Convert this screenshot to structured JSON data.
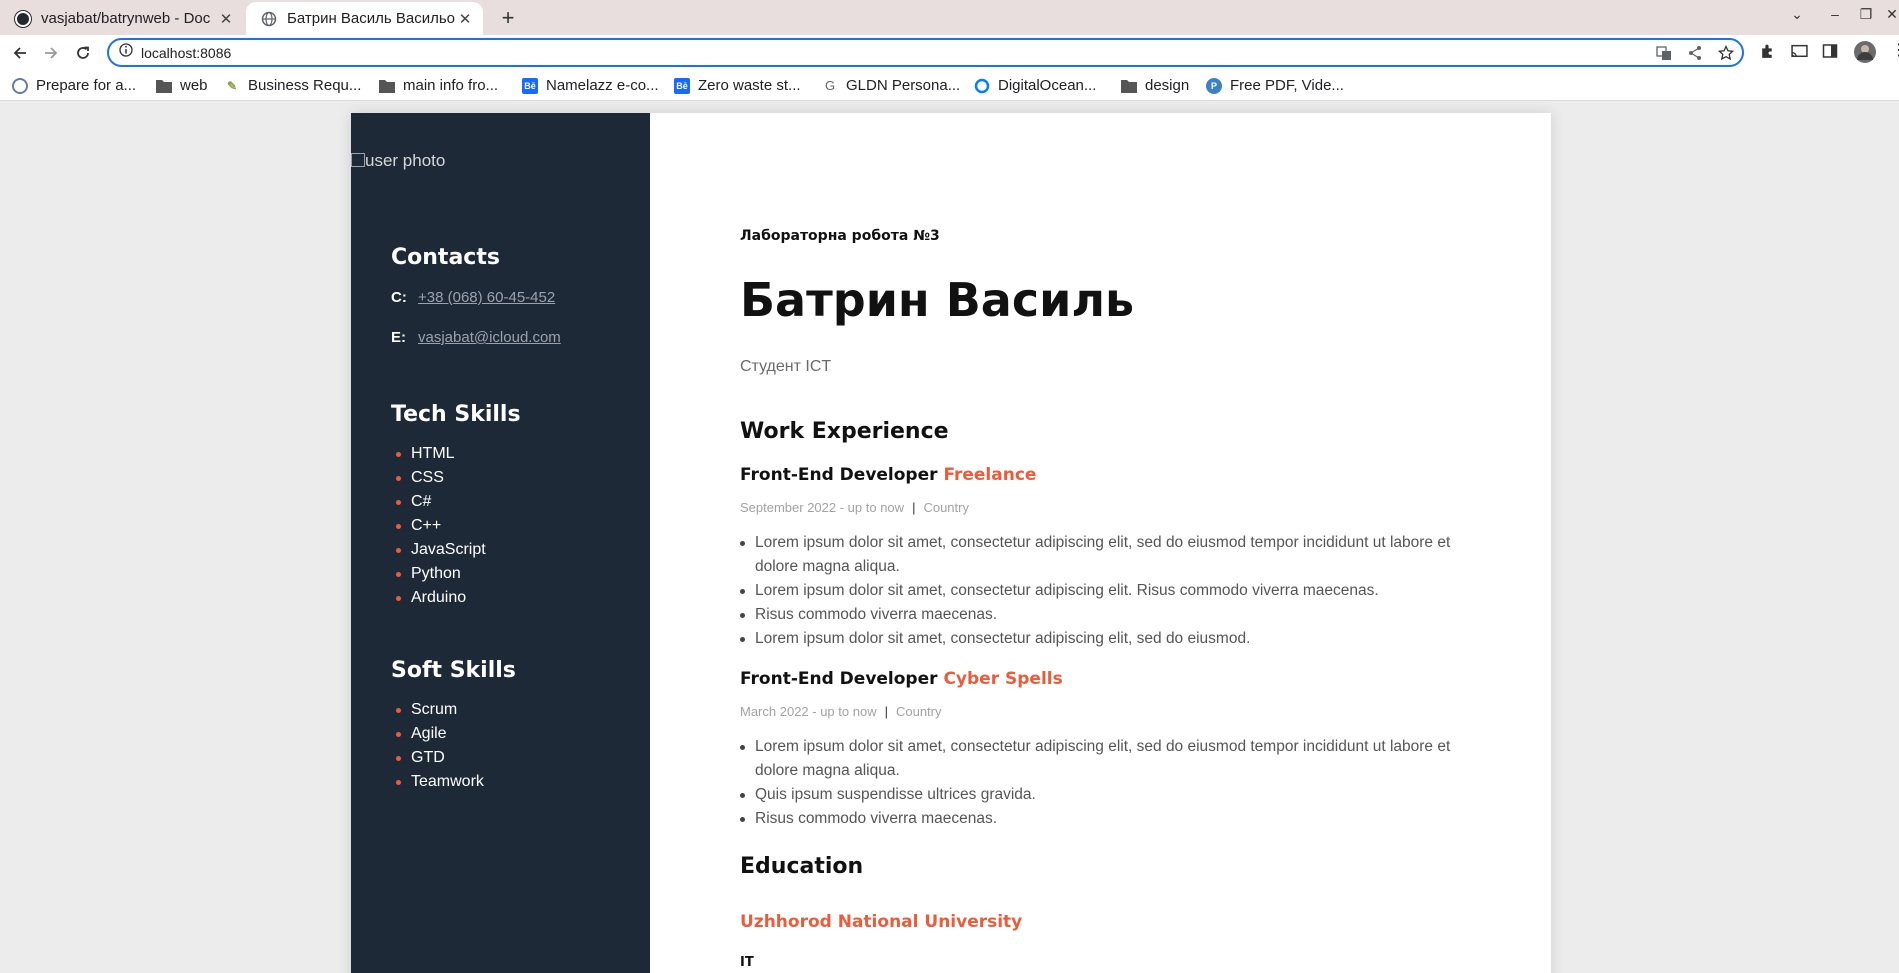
{
  "browser": {
    "tabs": [
      {
        "title": "vasjabat/batrynweb - Doc",
        "active": false
      },
      {
        "title": "Батрин Василь Васильо",
        "active": true
      }
    ],
    "url": "localhost:8086",
    "bookmarks": [
      {
        "label": "Prepare for a...",
        "icon": "page-icon"
      },
      {
        "label": "web",
        "icon": "folder-icon"
      },
      {
        "label": "Business Requ...",
        "icon": "site-icon"
      },
      {
        "label": "main info fro...",
        "icon": "folder-icon"
      },
      {
        "label": "Namelazz e-co...",
        "icon": "behance-icon"
      },
      {
        "label": "Zero waste st...",
        "icon": "behance-icon"
      },
      {
        "label": "GLDN Persona...",
        "icon": "google-icon"
      },
      {
        "label": "DigitalOcean...",
        "icon": "digitalocean-icon"
      },
      {
        "label": "design",
        "icon": "folder-icon"
      },
      {
        "label": "Free PDF, Vide...",
        "icon": "site-icon"
      }
    ]
  },
  "sidebar": {
    "photo_alt": "user photo",
    "contacts": {
      "heading": "Contacts",
      "phone_key": "C:",
      "phone": "+38 (068) 60-45-452",
      "email_key": "E:",
      "email": "vasjabat@icloud.com"
    },
    "tech": {
      "heading": "Tech Skills",
      "items": [
        "HTML",
        "CSS",
        "C#",
        "C++",
        "JavaScript",
        "Python",
        "Arduino"
      ]
    },
    "soft": {
      "heading": "Soft Skills",
      "items": [
        "Scrum",
        "Agile",
        "GTD",
        "Teamwork"
      ]
    }
  },
  "main": {
    "lab": "Лабораторна робота №3",
    "name": "Батрин Василь",
    "role": "Студент ICT",
    "work_heading": "Work Experience",
    "jobs": [
      {
        "title": "Front-End Developer",
        "company": "Freelance",
        "period": "September 2022 - up to now",
        "location": "Country",
        "bullets": [
          "Lorem ipsum dolor sit amet, consectetur adipiscing elit, sed do eiusmod tempor incididunt ut labore et dolore magna aliqua.",
          "Lorem ipsum dolor sit amet, consectetur adipiscing elit. Risus commodo viverra maecenas.",
          "Risus commodo viverra maecenas.",
          "Lorem ipsum dolor sit amet, consectetur adipiscing elit, sed do eiusmod."
        ]
      },
      {
        "title": "Front-End Developer",
        "company": "Cyber Spells",
        "period": "March 2022 - up to now",
        "location": "Country",
        "bullets": [
          "Lorem ipsum dolor sit amet, consectetur adipiscing elit, sed do eiusmod tempor incididunt ut labore et dolore magna aliqua.",
          "Quis ipsum suspendisse ultrices gravida.",
          "Risus commodo viverra maecenas."
        ]
      }
    ],
    "education_heading": "Education",
    "university": "Uzhhorod National University",
    "degree": "IT"
  },
  "colors": {
    "accent": "#ee5b3a",
    "sidebar_bg": "#1e2937",
    "page_bg": "#ececec"
  }
}
